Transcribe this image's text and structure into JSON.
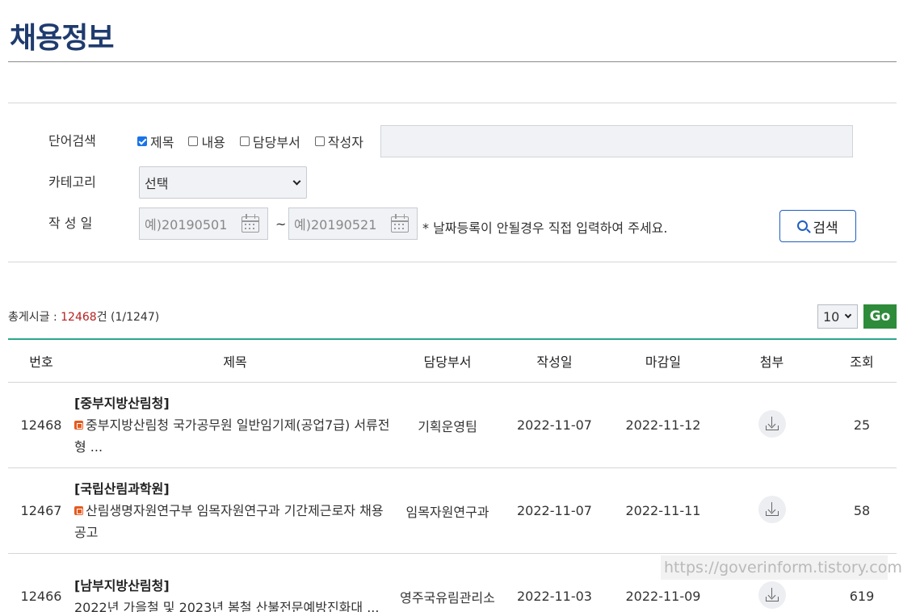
{
  "page": {
    "title": "채용정보"
  },
  "search": {
    "keyword_label": "단어검색",
    "checkboxes": [
      {
        "label": "제목",
        "checked": true
      },
      {
        "label": "내용",
        "checked": false
      },
      {
        "label": "담당부서",
        "checked": false
      },
      {
        "label": "작성자",
        "checked": false
      }
    ],
    "keyword_value": "",
    "category_label": "카테고리",
    "category_selected": "선택",
    "date_label": "작 성 일",
    "date_from_placeholder": "예)20190501",
    "date_to_placeholder": "예)20190521",
    "date_separator": "~",
    "date_note": "* 날짜등록이 안될경우 직접 입력하여 주세요.",
    "search_button": "검색"
  },
  "summary": {
    "prefix": "총게시글 : ",
    "count": "12468",
    "suffix": "건 (1/1247)"
  },
  "pagination": {
    "page_size": "10",
    "go_label": "Go"
  },
  "table": {
    "headers": [
      "번호",
      "제목",
      "담당부서",
      "작성일",
      "마감일",
      "첨부",
      "조회"
    ],
    "rows": [
      {
        "no": "12468",
        "org": "[중부지방산림청]",
        "title": "중부지방산림청 국가공무원 일반임기제(공업7급) 서류전형 ...",
        "is_new": true,
        "dept": "기획운영팀",
        "date": "2022-11-07",
        "due": "2022-11-12",
        "views": "25"
      },
      {
        "no": "12467",
        "org": "[국립산림과학원]",
        "title": "산림생명자원연구부 임목자원연구과 기간제근로자 채용 공고",
        "is_new": true,
        "dept": "임목자원연구과",
        "date": "2022-11-07",
        "due": "2022-11-11",
        "views": "58"
      },
      {
        "no": "12466",
        "org": "[남부지방산림청]",
        "title": "2022년 가을철 및 2023년 봄철 산불전문예방진화대 ...",
        "is_new": false,
        "dept": "영주국유림관리소",
        "date": "2022-11-03",
        "due": "2022-11-09",
        "views": "619"
      }
    ]
  },
  "watermark": "https://goverinform.tistory.com"
}
